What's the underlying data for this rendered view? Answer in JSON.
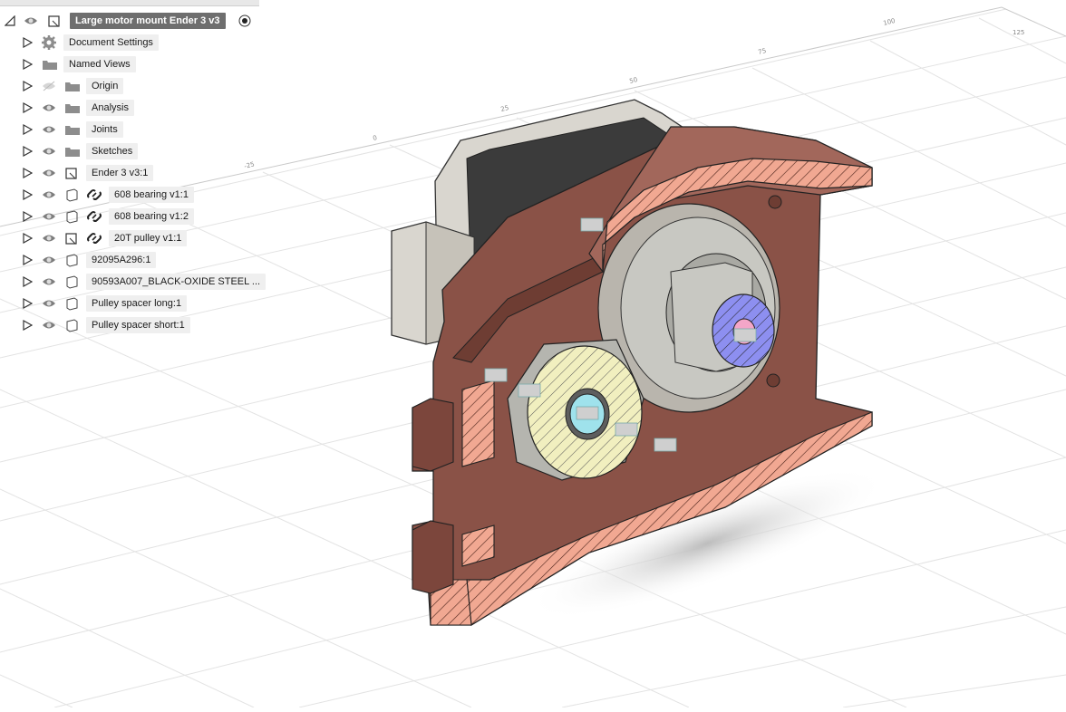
{
  "browser": {
    "root_label": "Large motor mount Ender 3 v3",
    "items": [
      {
        "label": "Document Settings",
        "kind": "settings"
      },
      {
        "label": "Named Views",
        "kind": "folder"
      },
      {
        "label": "Origin",
        "kind": "folder-hidden"
      },
      {
        "label": "Analysis",
        "kind": "folder"
      },
      {
        "label": "Joints",
        "kind": "folder"
      },
      {
        "label": "Sketches",
        "kind": "folder"
      },
      {
        "label": "Ender 3 v3:1",
        "kind": "component"
      },
      {
        "label": "608 bearing v1:1",
        "kind": "linked-body"
      },
      {
        "label": "608 bearing v1:2",
        "kind": "linked-body"
      },
      {
        "label": "20T pulley v1:1",
        "kind": "linked-component"
      },
      {
        "label": "92095A296:1",
        "kind": "body"
      },
      {
        "label": "90593A007_BLACK-OXIDE STEEL ...",
        "kind": "body"
      },
      {
        "label": "Pulley spacer long:1",
        "kind": "body"
      },
      {
        "label": "Pulley spacer short:1",
        "kind": "body"
      }
    ]
  },
  "viewport": {
    "grid_ticks": [
      "125",
      "100",
      "75",
      "50",
      "25",
      "0",
      "-25"
    ],
    "colors": {
      "body": "#8a5247",
      "body_dark": "#6e3d33",
      "body_light": "#a2675b",
      "section_fill": "#f1a892",
      "motor_dark": "#3b3b3b",
      "motor_light": "#d9d6cf",
      "bearing_steel": "#c8c8c2",
      "yellow_section": "#f1efbf",
      "blue_section": "#8d8ff0",
      "grid_line": "#e3e3e3"
    }
  }
}
